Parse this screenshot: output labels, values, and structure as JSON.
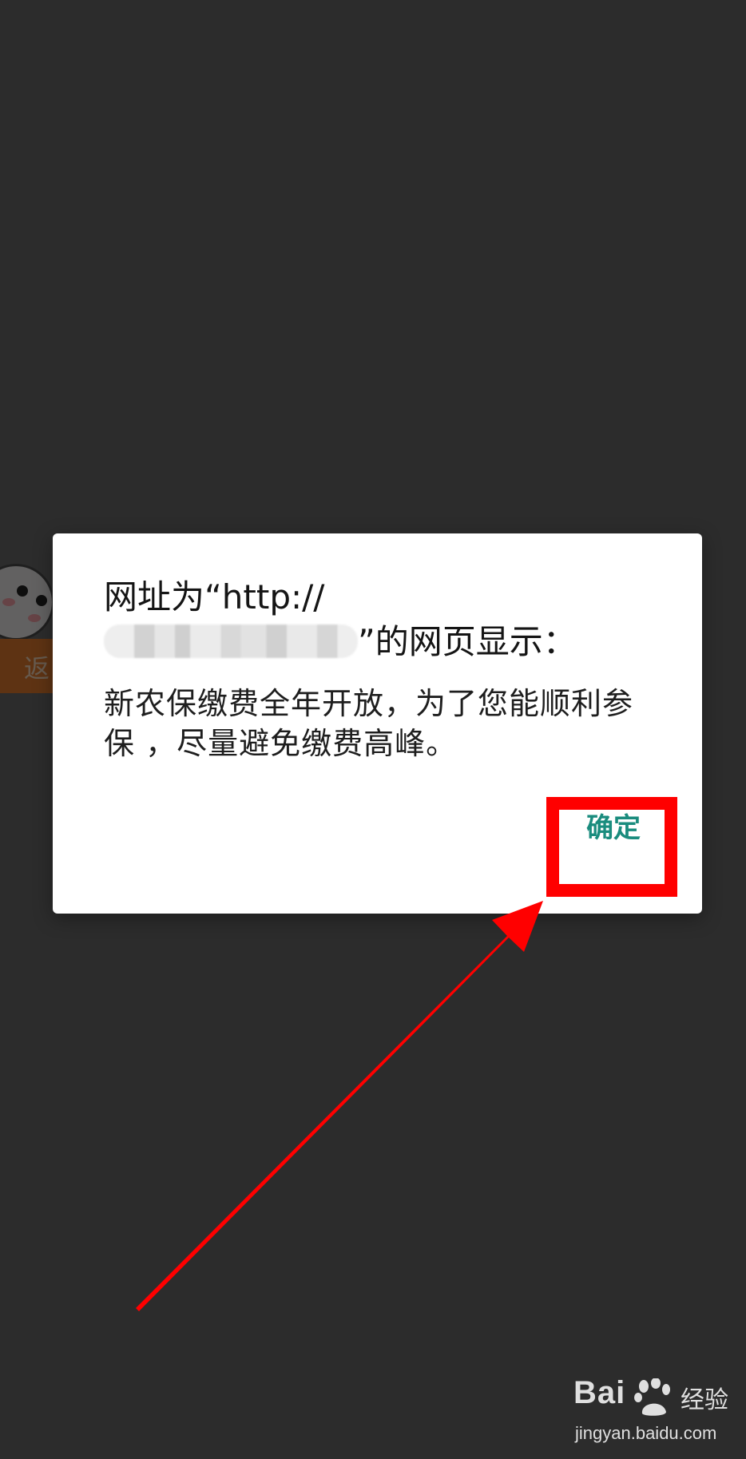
{
  "background": {
    "back_label": "返"
  },
  "dialog": {
    "title_line1": "网址为“http://",
    "title_line2_suffix": "”的网页显示：",
    "message": "新农保缴费全年开放，为了您能顺利参保 ，尽量避免缴费高峰。",
    "ok_label": "确定"
  },
  "annotation": {
    "color": "#ff0000"
  },
  "watermark": {
    "brand": "Bai",
    "brand_cn": "经验",
    "url": "jingyan.baidu.com"
  },
  "colors": {
    "accent": "#1a8c7e",
    "scrim": "#6a6a6a",
    "back_strip": "#e07a2e"
  }
}
